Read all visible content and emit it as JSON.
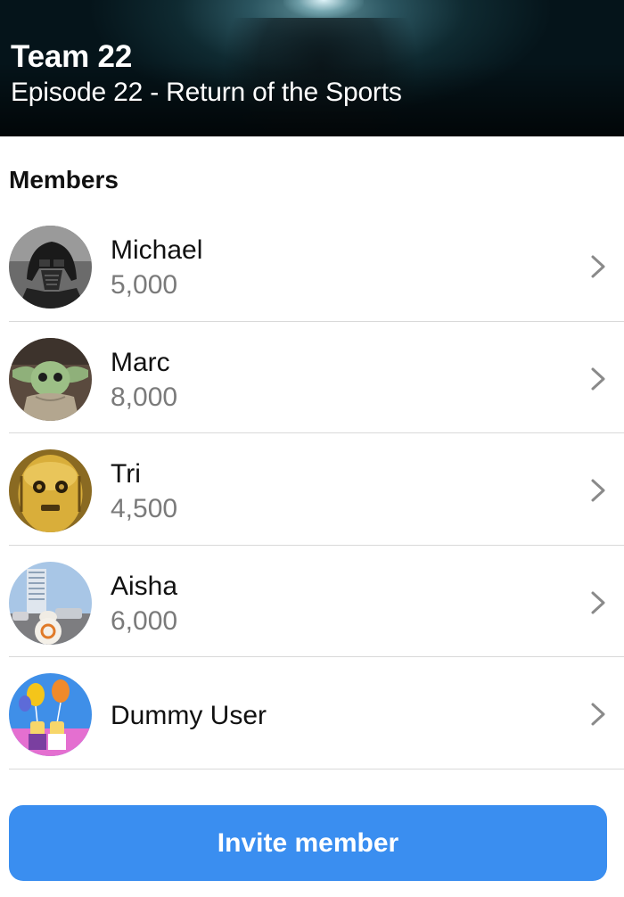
{
  "header": {
    "team_name": "Team 22",
    "episode": "Episode 22 - Return of the Sports"
  },
  "members_section": {
    "heading": "Members",
    "members": [
      {
        "name": "Michael",
        "score": "5,000",
        "avatar_icon": "masked-helmet-avatar"
      },
      {
        "name": "Marc",
        "score": "8,000",
        "avatar_icon": "green-alien-avatar"
      },
      {
        "name": "Tri",
        "score": "4,500",
        "avatar_icon": "gold-robot-avatar"
      },
      {
        "name": "Aisha",
        "score": "6,000",
        "avatar_icon": "rolling-droid-avatar"
      },
      {
        "name": "Dummy User",
        "score": "",
        "avatar_icon": "balloon-figures-avatar"
      }
    ],
    "row_action_icon": "chevron-right-icon"
  },
  "invite_button": {
    "label": "Invite member"
  },
  "colors": {
    "accent": "#3a8ef0",
    "secondary_text": "#7a7a7a",
    "divider": "#d9d9d9"
  }
}
